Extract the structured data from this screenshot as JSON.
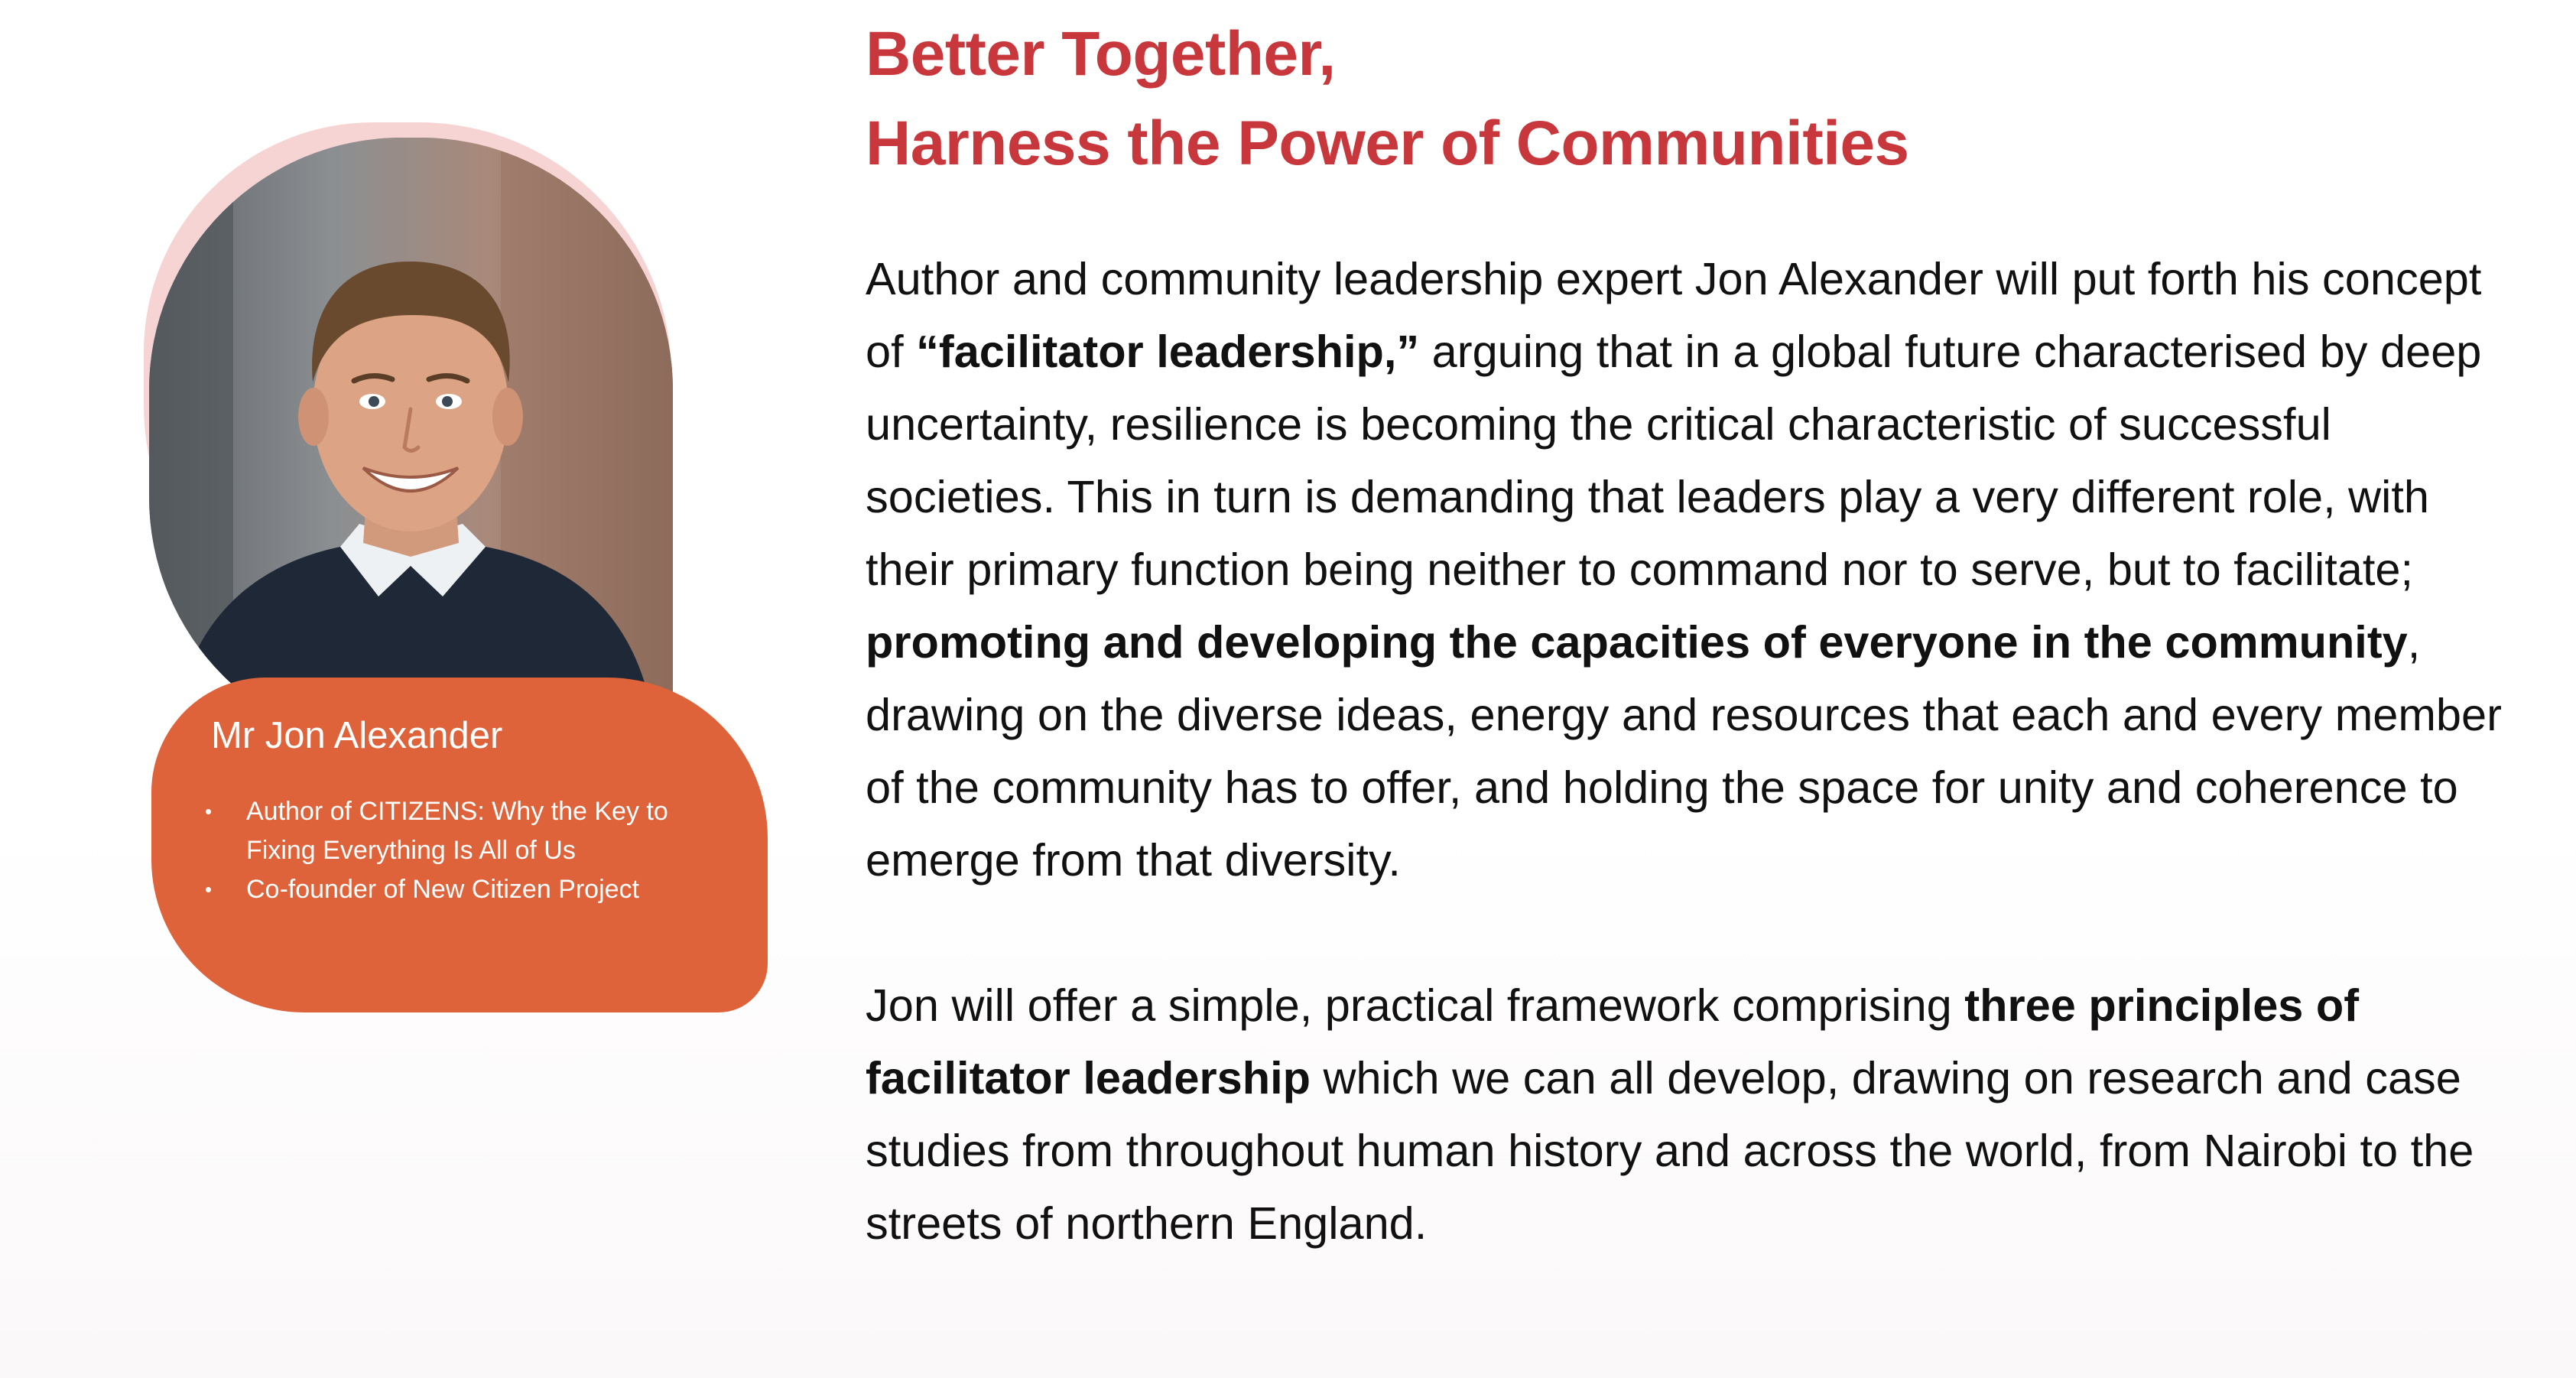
{
  "speaker": {
    "name": "Mr Jon Alexander",
    "credentials": [
      "Author of CITIZENS: Why the Key to Fixing Everything Is All of Us",
      "Co-founder of New Citizen Project"
    ]
  },
  "heading": {
    "line1": "Better Together,",
    "line2": "Harness the Power of Communities"
  },
  "para1": {
    "t1": "Author and community leadership expert Jon Alexander will put forth his concept of ",
    "b1": "“facilitator leadership,”",
    "t2": " arguing that in a global future characterised by deep uncertainty, resilience is becoming the critical characteristic of successful societies.  This in turn is demanding that leaders play a very different role, with their primary function being neither to command nor to serve, but to facilitate; ",
    "b2": "promoting and developing the capacities of everyone in the community",
    "t3": ", drawing on the diverse ideas, energy and resources that each and every member of the community has to offer, and holding the space for unity and coherence to emerge from that diversity."
  },
  "para2": {
    "t1": "Jon will offer a simple, practical framework comprising ",
    "b1": "three principles of facilitator leadership",
    "t2": " which we can all develop, drawing on research and case studies from throughout human history and across the world, from Nairobi to the streets of northern England."
  },
  "colors": {
    "heading": "#c8373b",
    "name_bubble": "#df633a",
    "photo_halo": "#f6d4d4",
    "body_text": "#111111"
  }
}
